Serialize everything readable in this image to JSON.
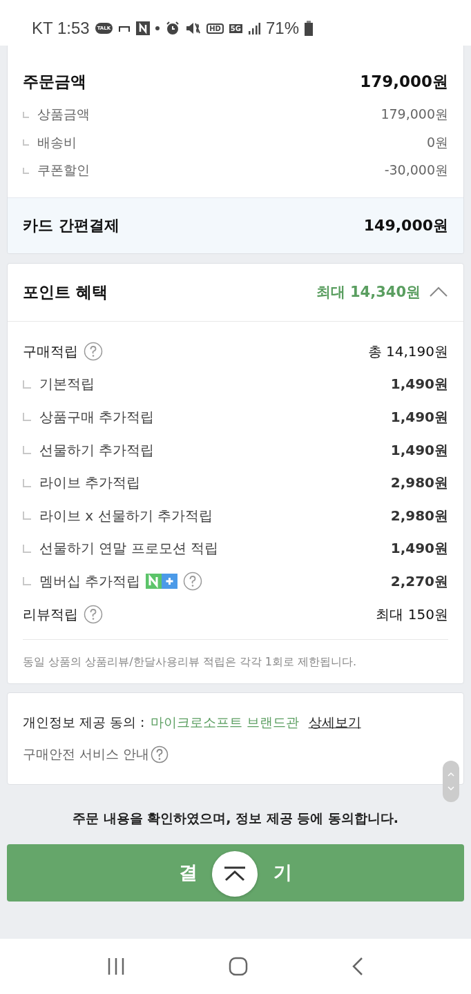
{
  "status_bar": {
    "carrier": "KT",
    "time": "1:53",
    "talk_badge": "TALK",
    "hd_badge": "HD",
    "network": "5G",
    "battery": "71%"
  },
  "order_summary": {
    "title": "주문금액",
    "total": "179,000원",
    "items": [
      {
        "label": "상품금액",
        "value": "179,000원"
      },
      {
        "label": "배송비",
        "value": "0원"
      },
      {
        "label": "쿠폰할인",
        "value": "-30,000원"
      }
    ],
    "payment": {
      "label": "카드 간편결제",
      "value": "149,000원"
    }
  },
  "points": {
    "title": "포인트 혜택",
    "max": "최대 14,340원",
    "expanded": true,
    "rows": [
      {
        "kind": "main",
        "label": "구매적립",
        "help": true,
        "value": "총 14,190원"
      },
      {
        "kind": "sub",
        "label": "기본적립",
        "value": "1,490원"
      },
      {
        "kind": "sub",
        "label": "상품구매 추가적립",
        "value": "1,490원"
      },
      {
        "kind": "sub",
        "label": "선물하기 추가적립",
        "value": "1,490원"
      },
      {
        "kind": "sub",
        "label": "라이브 추가적립",
        "value": "2,980원"
      },
      {
        "kind": "sub",
        "label": "라이브 x 선물하기 추가적립",
        "value": "2,980원"
      },
      {
        "kind": "sub",
        "label": "선물하기 연말 프로모션 적립",
        "value": "1,490원"
      },
      {
        "kind": "sub",
        "label": "멤버십 추가적립",
        "badge": true,
        "help": true,
        "value": "2,270원"
      },
      {
        "kind": "main",
        "label": "리뷰적립",
        "help": true,
        "value": "최대 150원"
      }
    ],
    "note": "동일 상품의 상품리뷰/한달사용리뷰 적립은 각각 1회로 제한됩니다."
  },
  "consent": {
    "label": "개인정보 제공 동의 :",
    "brand": "마이크로소프트 브랜드관",
    "details_link": "상세보기",
    "safety": "구매안전 서비스 안내"
  },
  "agreement": "주문 내용을 확인하였으며, 정보 제공 등에 동의합니다.",
  "pay_button": {
    "visible_parts": [
      "결",
      "기"
    ]
  }
}
